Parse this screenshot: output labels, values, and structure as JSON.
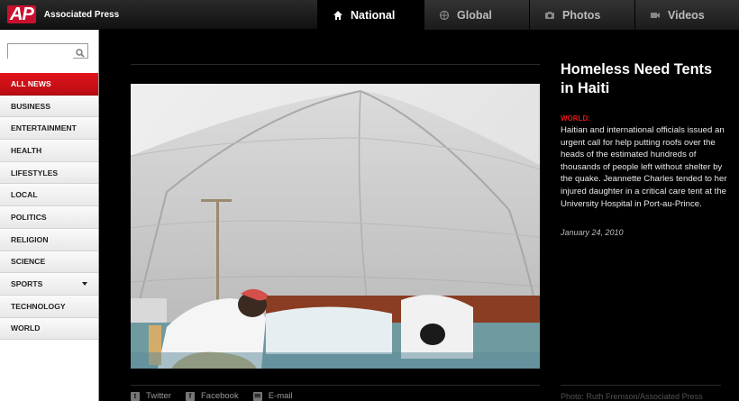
{
  "header": {
    "logo_mark": "AP",
    "site_name": "Associated Press",
    "tabs": [
      {
        "label": "National",
        "icon": "home-icon",
        "active": true
      },
      {
        "label": "Global",
        "icon": "globe-icon",
        "active": false
      },
      {
        "label": "Photos",
        "icon": "camera-icon",
        "active": false
      },
      {
        "label": "Videos",
        "icon": "video-icon",
        "active": false
      }
    ]
  },
  "sidebar": {
    "search": {
      "value": "",
      "placeholder": "",
      "icon": "search-icon"
    },
    "items": [
      {
        "label": "ALL NEWS",
        "active": true
      },
      {
        "label": "BUSINESS"
      },
      {
        "label": "ENTERTAINMENT"
      },
      {
        "label": "HEALTH"
      },
      {
        "label": "LIFESTYLES"
      },
      {
        "label": "LOCAL"
      },
      {
        "label": "POLITICS"
      },
      {
        "label": "RELIGION"
      },
      {
        "label": "SCIENCE"
      },
      {
        "label": "SPORTS",
        "has_dropdown": true
      },
      {
        "label": "TECHNOLOGY"
      },
      {
        "label": "WORLD"
      }
    ]
  },
  "article": {
    "headline": "Homeless Need Tents in Haiti",
    "section": "WORLD:",
    "body": "Haitian and international officials issued an urgent call for help putting roofs over the heads of the estimated hundreds of thousands of people left without shelter by the quake. Jeannette Charles tended to her injured daughter in a critical care tent at the University Hospital in Port-au-Prince.",
    "date": "January 24, 2010",
    "photo_credit": "Photo: Ruth Fremson/Associated Press"
  },
  "share": [
    {
      "label": "Twitter",
      "icon": "twitter-icon"
    },
    {
      "label": "Facebook",
      "icon": "facebook-icon"
    },
    {
      "label": "E-mail",
      "icon": "email-icon"
    }
  ],
  "colors": {
    "accent": "#e0141b",
    "background": "#000000"
  }
}
